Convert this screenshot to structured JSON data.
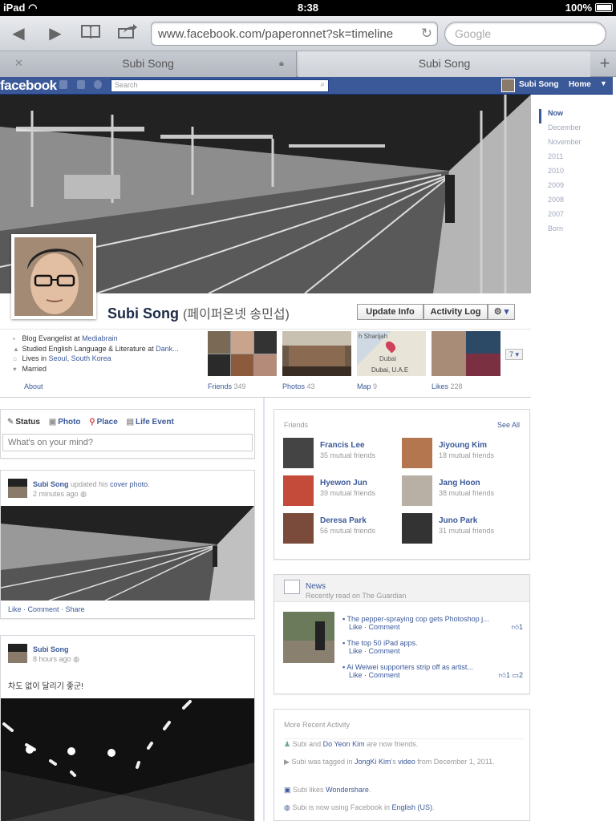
{
  "statusbar": {
    "device": "iPad",
    "time": "8:38",
    "battery": "100%"
  },
  "browser": {
    "url": "www.facebook.com/paperonnet?sk=timeline",
    "search_placeholder": "Google",
    "tabs": [
      {
        "label": "Subi Song"
      },
      {
        "label": "Subi Song"
      }
    ]
  },
  "fb": {
    "logo": "facebook",
    "search_placeholder": "Search",
    "user": "Subi Song",
    "home": "Home"
  },
  "timeline_nav": [
    "Now",
    "December",
    "November",
    "2011",
    "2010",
    "2009",
    "2008",
    "2007",
    "Born"
  ],
  "profile": {
    "name": "Subi Song",
    "alt_name": "(페이퍼온넷 송민섭)",
    "update_info": "Update Info",
    "activity_log": "Activity Log",
    "about": [
      {
        "prefix": "Blog Evangelist at ",
        "link": "Mediabrain"
      },
      {
        "prefix": "Studied English Language & Literature at ",
        "link": "Dank..."
      },
      {
        "prefix": "Lives in ",
        "link": "Seoul, South Korea"
      },
      {
        "prefix": "Married",
        "link": ""
      }
    ],
    "about_link": "About"
  },
  "apps": [
    {
      "label": "Friends",
      "count": "349"
    },
    {
      "label": "Photos",
      "count": "43"
    },
    {
      "label": "Map",
      "count": "9",
      "map_top": "h Sharijah",
      "map_city": "Dubai",
      "map_caption": "Dubai, U.A.E"
    },
    {
      "label": "Likes",
      "count": "228"
    }
  ],
  "apps_more": "7",
  "composer": {
    "tabs": [
      "Status",
      "Photo",
      "Place",
      "Life Event"
    ],
    "placeholder": "What's on your mind?"
  },
  "posts": [
    {
      "author": "Subi Song",
      "action": " updated his ",
      "action_link": "cover photo.",
      "time": "2 minutes ago",
      "actions": "Like · Comment · Share"
    },
    {
      "author": "Subi Song",
      "time": "8 hours ago",
      "text": "차도 없이 달리기 좋군!"
    }
  ],
  "friends_box": {
    "title": "Friends",
    "see_all": "See All",
    "items": [
      {
        "name": "Francis Lee",
        "mutual": "35 mutual friends"
      },
      {
        "name": "Jiyoung Kim",
        "mutual": "18 mutual friends"
      },
      {
        "name": "Hyewon Jun",
        "mutual": "39 mutual friends"
      },
      {
        "name": "Jang Hoon",
        "mutual": "38 mutual friends"
      },
      {
        "name": "Deresa Park",
        "mutual": "56 mutual friends"
      },
      {
        "name": "Juno Park",
        "mutual": "31 mutual friends"
      }
    ]
  },
  "news": {
    "title": "News",
    "subtitle": "Recently read on The Guardian",
    "items": [
      {
        "title": "The pepper-spraying cop gets Photoshop j...",
        "actions": "Like · Comment",
        "likes": "1",
        "comments": ""
      },
      {
        "title": "The top 50 iPad apps.",
        "actions": "Like · Comment",
        "likes": "",
        "comments": ""
      },
      {
        "title": "Ai Weiwei supporters strip off as artist...",
        "actions": "Like · Comment",
        "likes": "1",
        "comments": "2"
      }
    ]
  },
  "recent_activity": {
    "title": "More Recent Activity",
    "items": [
      {
        "t1": "Subi and ",
        "l1": "Do Yeon Kim",
        "t2": " are now friends.",
        "l2": "",
        "t3": ""
      },
      {
        "t1": "Subi was tagged in ",
        "l1": "JongKi Kim",
        "t2": "'s ",
        "l2": "video",
        "t3": " from December 1, 2011."
      },
      {
        "t1": "Subi likes ",
        "l1": "Wondershare",
        "t2": ".",
        "l2": "",
        "t3": ""
      },
      {
        "t1": "Subi is now using Facebook in ",
        "l1": "English (US)",
        "t2": ".",
        "l2": "",
        "t3": ""
      }
    ]
  }
}
